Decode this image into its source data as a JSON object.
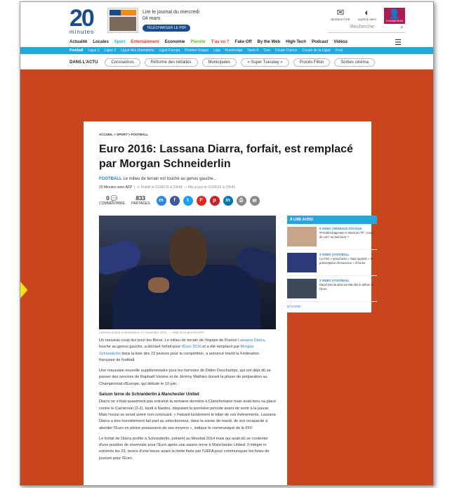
{
  "header": {
    "logo_number": "20",
    "logo_sub": "minutes",
    "promo_text": "Lire le journal du mercredi 04 mars",
    "promo_button": "TÉLÉCHARGER LE PDF",
    "icons": [
      {
        "name": "newsletter",
        "label": "NEWSLETTER",
        "glyph": "✉"
      },
      {
        "name": "alerts",
        "label": "ALERTE INFO",
        "glyph": "◐"
      },
      {
        "name": "connect",
        "label": "CONNEXION",
        "glyph": "👤"
      }
    ],
    "search_placeholder": "Recherche",
    "menu_label": "MENU"
  },
  "main_nav": [
    {
      "label": "Actualité",
      "color": "#1d1d1d"
    },
    {
      "label": "Locales",
      "color": "#1d1d1d"
    },
    {
      "label": "Sport",
      "color": "#21a9de"
    },
    {
      "label": "Entertainment",
      "color": "#e5312a"
    },
    {
      "label": "Economie",
      "color": "#1d1d1d"
    },
    {
      "label": "Planète",
      "color": "#6bb33a"
    },
    {
      "label": "T'as vu ?",
      "color": "#e5312a"
    },
    {
      "label": "Fake Off",
      "color": "#1d1d1d"
    },
    {
      "label": "By the Web",
      "color": "#1d1d1d"
    },
    {
      "label": "High-Tech",
      "color": "#1d1d1d"
    },
    {
      "label": "Podcast",
      "color": "#1d1d1d"
    },
    {
      "label": "Vidéos",
      "color": "#1d1d1d"
    }
  ],
  "sub_nav": [
    "Football",
    "Ligue 1",
    "Ligue 2",
    "Ligue des champions",
    "Ligue Europa",
    "Premier league",
    "Liga",
    "Bundesliga",
    "Serie A",
    "Can",
    "Coupe France",
    "Coupe de la Ligue",
    "Foot"
  ],
  "actu": {
    "label": "DANS L'ACTU",
    "pills": [
      "Coronavirus",
      "Réforme des retraites",
      "Municipales",
      "« Super Tuesday »",
      "Procès Fillon",
      "Sorties cinéma"
    ]
  },
  "article": {
    "breadcrumb": "ACCUEIL > SPORT > FOOTBALL",
    "title": "Euro 2016: Lassana Diarra, forfait, est remplacé par Morgan Schneiderlin",
    "category": "FOOTBALL",
    "lede": "Le milieu de terrain est touché au genou gauche...",
    "author": "20 Minutes avec AFP",
    "date_text": "Publié le 01/06/16 à 03h41 — Mis à jour le 01/06/16 à 03h41",
    "comments_count": "0",
    "comments_label": "COMMENTAIRE",
    "shares_count": "833",
    "shares_label": "PARTAGES",
    "share_buttons": [
      {
        "name": "messenger",
        "glyph": "m",
        "color": "#2d88e0"
      },
      {
        "name": "facebook",
        "glyph": "f",
        "color": "#3b5998"
      },
      {
        "name": "twitter",
        "glyph": "t",
        "color": "#1da1f2"
      },
      {
        "name": "flipboard",
        "glyph": "F",
        "color": "#e12828"
      },
      {
        "name": "pinterest",
        "glyph": "p",
        "color": "#cb2027"
      },
      {
        "name": "linkedin",
        "glyph": "in",
        "color": "#0077b5"
      },
      {
        "name": "print",
        "glyph": "⎙",
        "color": "#8a8a8a"
      },
      {
        "name": "email",
        "glyph": "✉",
        "color": "#8a8a8a"
      }
    ],
    "caption": "Lassana Diarra à Montréal le 17 novembre 2015. — Matt Dunham/AP/SIPA",
    "p1_a": "Un nouveau coup dur pour les Bleus. Le milieu de terrain de l'équipe de France ",
    "p1_link1": "Lassana Diarra",
    "p1_b": ", touché au genou gauche, a déclaré forfait pour ",
    "p1_link2": "l'Euro 2016",
    "p1_c": " et a été remplacé par ",
    "p1_link3": "Morgan Schneiderlin",
    "p1_d": " dans la liste des 23 joueurs pour la compétition, a annoncé mardi la Fédération française de football.",
    "p2": "Une mauvaise nouvelle supplémentaire pour les hommes de Didier Deschamps, qui ont déjà dû se passer des services de Raphaël Varane et de Jérémy Mathieu durant la phase de préparation au Championnat d'Europe, qui débute le 10 juin.",
    "h3": "Saison terne de Schneiderlin à Manchester United",
    "p3": "Diarra ne s'était quasiment pas entraîné la semaine dernière à Clairefontaine mais avait tenu sa place contre le Cameroun (3-2), lundi à Nantes, disputant la première période avant de sortir à la pause. Mais l'essai se serait avéré non concluant. « Faisant lucidement le bilan de ces événements, Lassana Diarra a très honnêtement fait part au sélectionneur, dans la soirée de mardi, de son incapacité à aborder l'Euro en pleine possession de ses moyens », indique le communiqué de la FFF.",
    "p4": "Le forfait de Diarra profite à Schneiderlin, présent au Mondial 2014 mais qui avait dû se contenter d'une position de réserviste pour l'Euro après une saison terne à Manchester United. Il intègre in extremis les 23, moins d'une heure avant la limite fixée par l'UEFA pour communiquer les listes de joueurs pour l'Euro."
  },
  "aside": {
    "head": "À LIRE AUSSI",
    "items": [
      {
        "cat": "5 VIDEO | RÉSEAUX SOCIAUX",
        "text": "#FrédéricDagenais le tweet du TP : Coup de com' ou bad buzz ?",
        "color": "#c8a58a"
      },
      {
        "cat": "3 VIDEO | FOOTBALL",
        "text": "La FSG « prend acte » mais regrette « la présomption d'innocence » d'Aurier",
        "color": "#2a3a7a"
      },
      {
        "cat": "3 VIDEO | FOOTBALL",
        "text": "David Ginola sera sur M6 dès le début de l'Euro",
        "color": "#3c4a5c"
      }
    ],
    "more": "D'AUTRE"
  }
}
